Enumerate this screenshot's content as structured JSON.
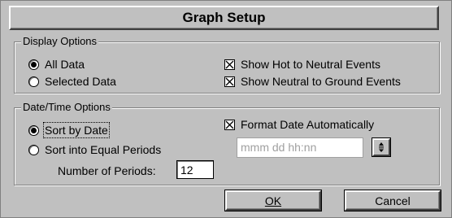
{
  "dialog": {
    "title": "Graph Setup"
  },
  "display_options": {
    "legend": "Display Options",
    "all_data": "All Data",
    "selected_data": "Selected Data",
    "show_hot_neutral": "Show Hot to Neutral Events",
    "show_neutral_ground": "Show Neutral to Ground Events",
    "selected": "All Data",
    "checked": {
      "show_hot_neutral": true,
      "show_neutral_ground": true
    }
  },
  "datetime_options": {
    "legend": "Date/Time Options",
    "sort_by_date": "Sort by Date",
    "sort_equal_periods": "Sort into Equal Periods",
    "num_periods_label": "Number of Periods:",
    "num_periods_value": "12",
    "format_date_auto": "Format Date Automatically",
    "format_placeholder": "mmm dd hh:nn",
    "selected": "Sort by Date",
    "checked": {
      "format_date_auto": true
    }
  },
  "buttons": {
    "ok": "OK",
    "cancel": "Cancel"
  },
  "icons": {
    "picker_button": "dropdown-arrows-icon",
    "check": "check-x-icon"
  }
}
